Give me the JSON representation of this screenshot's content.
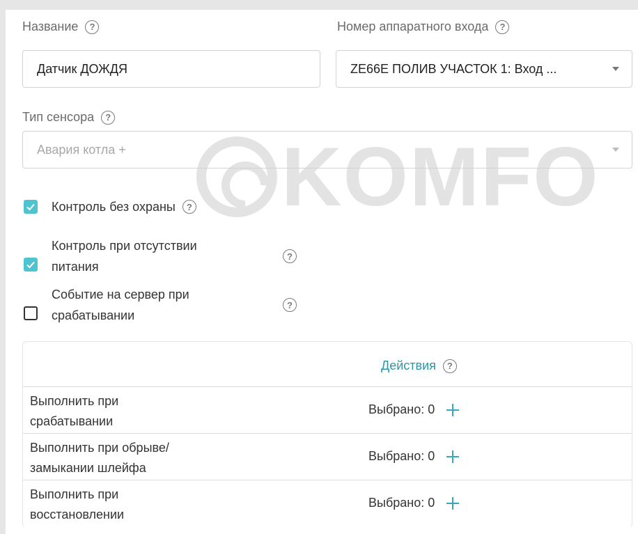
{
  "form": {
    "name_label": "Название",
    "name_value": "Датчик ДОЖДЯ",
    "input_label": "Номер аппаратного входа",
    "input_value": "ZE66E ПОЛИВ УЧАСТОК 1: Вход ...",
    "sensor_type_label": "Тип сенсора",
    "sensor_type_placeholder": "Авария котла +",
    "help_glyph": "?"
  },
  "checkboxes": [
    {
      "label": "Контроль без охраны",
      "checked": true
    },
    {
      "label_line1": "Контроль при отсутствии",
      "label_line2": "питания",
      "checked": true
    },
    {
      "label_line1": "Событие на сервер при",
      "label_line2": "срабатывании",
      "checked": false
    }
  ],
  "actions_table": {
    "header": "Действия",
    "rows": [
      {
        "line1": "Выполнить при",
        "line2": "срабатывании",
        "count": "Выбрано: 0"
      },
      {
        "line1": "Выполнить при обрыве/",
        "line2": "замыкании шлейфа",
        "count": "Выбрано: 0"
      },
      {
        "line1": "Выполнить при",
        "line2": "восстановлении",
        "count": "Выбрано: 0"
      }
    ]
  },
  "watermark": "KOMFO",
  "colors": {
    "accent": "#4fc3cf",
    "link": "#2b97a8",
    "plus": "#36a9b8"
  }
}
